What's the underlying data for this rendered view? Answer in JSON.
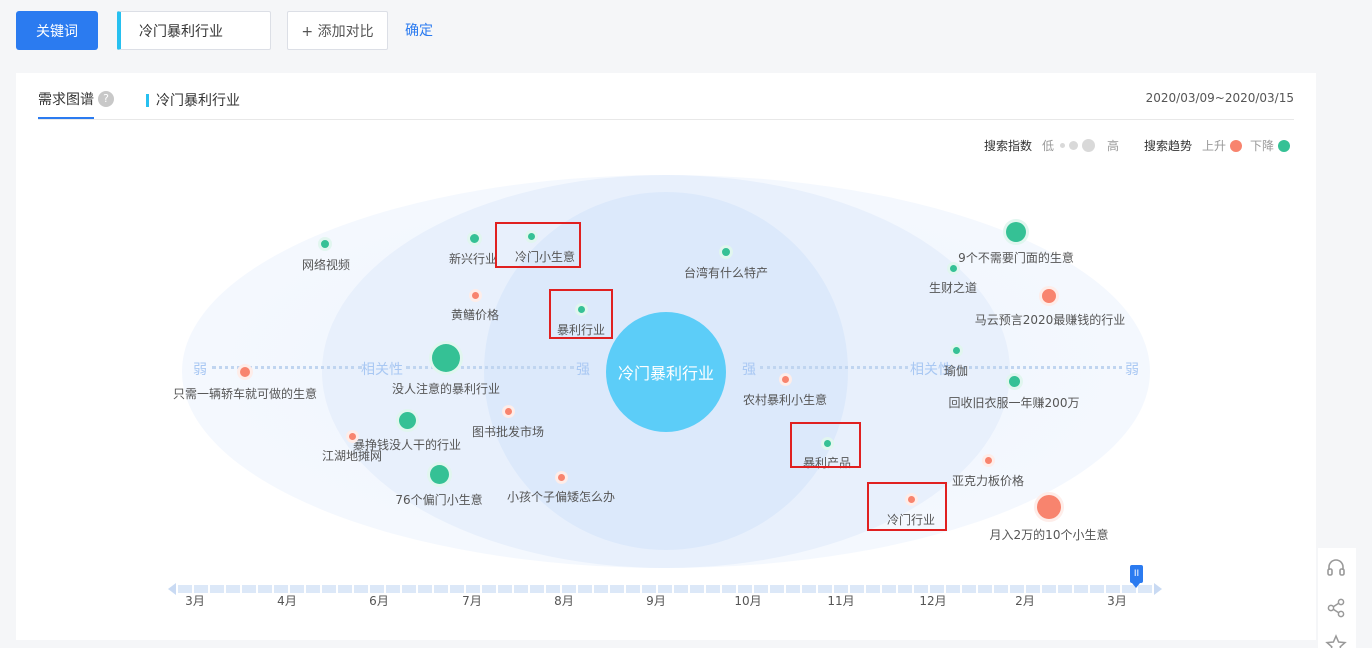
{
  "toolbar": {
    "keyword_button": "关键词",
    "keyword_value": "冷门暴利行业",
    "add_compare": "+ 添加对比",
    "confirm": "确定"
  },
  "panel": {
    "tab_label": "需求图谱",
    "help_icon": "?",
    "series_name": "冷门暴利行业",
    "date_range": "2020/03/09~2020/03/15",
    "legend": {
      "index_label": "搜索指数",
      "low": "低",
      "high": "高",
      "trend_label": "搜索趋势",
      "up": "上升",
      "down": "下降",
      "up_color": "#f8846e",
      "down_color": "#35c195"
    }
  },
  "graph": {
    "center": "冷门暴利行业",
    "axis": {
      "weak_left": "弱",
      "relevance_left": "相关性",
      "strong_left": "强",
      "strong_right": "强",
      "relevance_right": "相关性",
      "weak_right": "弱"
    },
    "nodes": [
      {
        "label": "网络视频",
        "trend": "down"
      },
      {
        "label": "新兴行业",
        "trend": "down"
      },
      {
        "label": "冷门小生意",
        "trend": "down"
      },
      {
        "label": "台湾有什么特产",
        "trend": "down"
      },
      {
        "label": "9个不需要门面的生意",
        "trend": "down"
      },
      {
        "label": "生财之道",
        "trend": "down"
      },
      {
        "label": "黄鳝价格",
        "trend": "up"
      },
      {
        "label": "暴利行业",
        "trend": "down"
      },
      {
        "label": "马云预言2020最赚钱的行业",
        "trend": "up"
      },
      {
        "label": "只需一辆轿车就可做的生意",
        "trend": "up"
      },
      {
        "label": "没人注意的暴利行业",
        "trend": "down"
      },
      {
        "label": "瑜伽",
        "trend": "down"
      },
      {
        "label": "农村暴利小生意",
        "trend": "up"
      },
      {
        "label": "回收旧衣服一年赚200万",
        "trend": "down"
      },
      {
        "label": "图书批发市场",
        "trend": "up"
      },
      {
        "label": "暴挣钱没人干的行业",
        "trend": "down"
      },
      {
        "label": "江湖地摊网",
        "trend": "up"
      },
      {
        "label": "暴利产品",
        "trend": "down"
      },
      {
        "label": "亚克力板价格",
        "trend": "up"
      },
      {
        "label": "76个偏门小生意",
        "trend": "down"
      },
      {
        "label": "小孩个子偏矮怎么办",
        "trend": "up"
      },
      {
        "label": "冷门行业",
        "trend": "up"
      },
      {
        "label": "月入2万的10个小生意",
        "trend": "up"
      }
    ]
  },
  "timeline": {
    "months": [
      "3月",
      "4月",
      "6月",
      "7月",
      "8月",
      "9月",
      "10月",
      "11月",
      "12月",
      "2月",
      "3月"
    ],
    "handle_icon": "pause-icon"
  },
  "float_icons": [
    "headset-icon",
    "share-icon",
    "star-icon"
  ]
}
